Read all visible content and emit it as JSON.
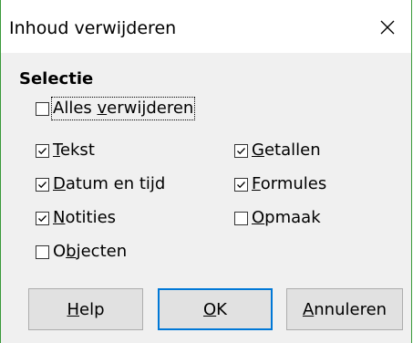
{
  "window": {
    "title": "Inhoud verwijderen",
    "close_glyph": "✕"
  },
  "selection": {
    "heading": "Selectie",
    "delete_all": {
      "prefix": "Alles ",
      "accel": "v",
      "suffix": "erwijderen",
      "checked": false
    },
    "options": [
      {
        "key": "text",
        "prefix": "",
        "accel": "T",
        "suffix": "ekst",
        "checked": true
      },
      {
        "key": "numbers",
        "prefix": "",
        "accel": "G",
        "suffix": "etallen",
        "checked": true
      },
      {
        "key": "datetime",
        "prefix": "",
        "accel": "D",
        "suffix": "atum en tijd",
        "checked": true
      },
      {
        "key": "formulas",
        "prefix": "",
        "accel": "F",
        "suffix": "ormules",
        "checked": true
      },
      {
        "key": "notes",
        "prefix": "",
        "accel": "N",
        "suffix": "otities",
        "checked": true
      },
      {
        "key": "format",
        "prefix": "",
        "accel": "O",
        "suffix": "pmaak",
        "checked": false
      },
      {
        "key": "objects",
        "prefix": "O",
        "accel": "b",
        "suffix": "jecten",
        "checked": false
      }
    ]
  },
  "buttons": {
    "help": {
      "prefix": "",
      "accel": "H",
      "suffix": "elp"
    },
    "ok": {
      "prefix": "",
      "accel": "O",
      "suffix": "K"
    },
    "cancel": {
      "prefix": "",
      "accel": "A",
      "suffix": "nnuleren"
    }
  },
  "colors": {
    "accent": "#0078d7",
    "window_border": "#3a9a3a",
    "client_bg": "#f0f0f0",
    "button_bg": "#e1e1e1"
  }
}
